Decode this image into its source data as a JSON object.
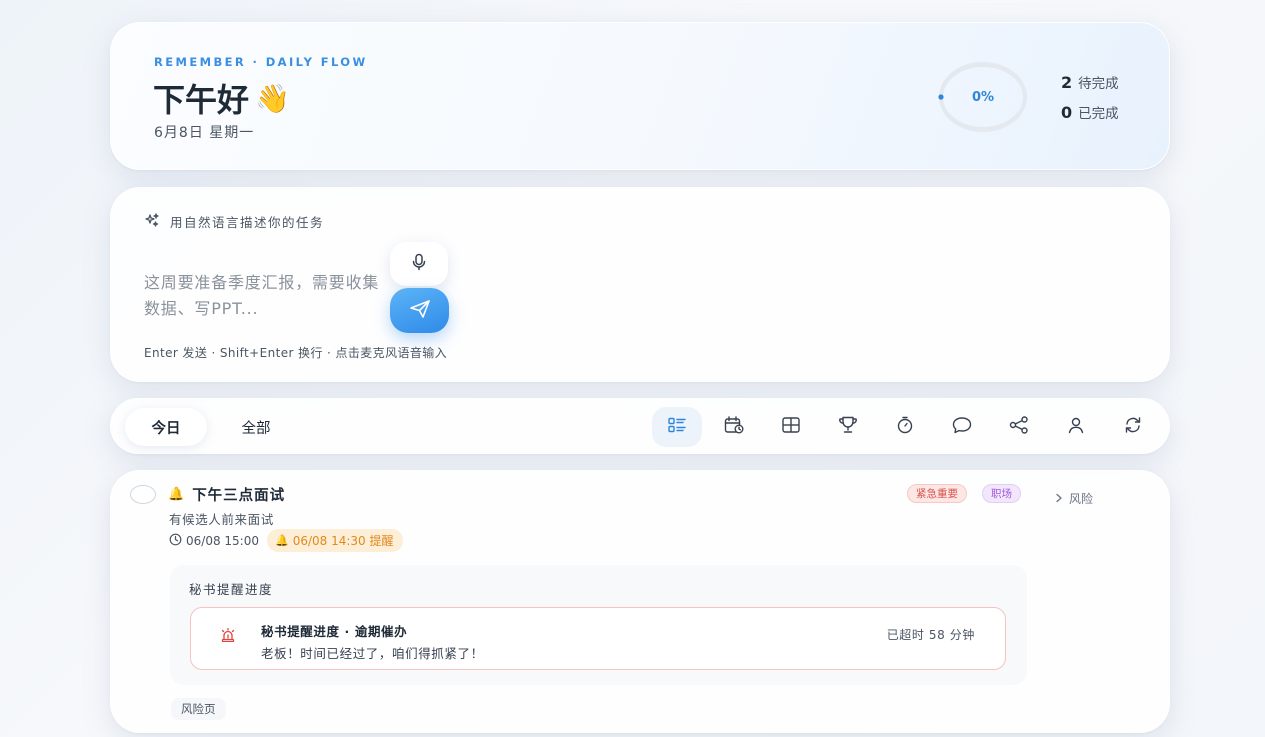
{
  "header": {
    "eyebrow": "REMEMBER · DAILY FLOW",
    "greeting": "下午好",
    "greeting_emoji": "👋",
    "date": "6月8日 星期一",
    "progress_label": "0%",
    "progress_value": 0,
    "pending_count": "2",
    "pending_label": "待完成",
    "done_count": "0",
    "done_label": "已完成",
    "accent_color": "#2f86d8"
  },
  "composer": {
    "hint": "用自然语言描述你的任务",
    "placeholder": "这周要准备季度汇报，需要收集数据、写PPT...",
    "shortcut_hint": "Enter 发送 · Shift+Enter 换行 · 点击麦克风语音输入",
    "mic_icon": "microphone-icon",
    "send_icon": "send-icon"
  },
  "tabs": {
    "today": "今日",
    "all": "全部",
    "views": [
      {
        "name": "list-view-icon",
        "active": true
      },
      {
        "name": "calendar-view-icon",
        "active": false
      },
      {
        "name": "grid-view-icon",
        "active": false
      },
      {
        "name": "trophy-icon",
        "active": false
      },
      {
        "name": "timer-icon",
        "active": false
      },
      {
        "name": "chat-icon",
        "active": false
      },
      {
        "name": "share-icon",
        "active": false
      },
      {
        "name": "profile-icon",
        "active": false
      },
      {
        "name": "refresh-icon",
        "active": false
      }
    ]
  },
  "task": {
    "bell": "🔔",
    "title": "下午三点面试",
    "description": "有候选人前来面试",
    "due": "06/08 15:00",
    "reminder": "06/08 14:30 提醒",
    "tags": {
      "urgent": "紧急重要",
      "work": "职场"
    },
    "risk_toggle": "风险",
    "secretary_title": "秘书提醒进度",
    "alert": {
      "title": "秘书提醒进度 · 逾期催办",
      "message": "老板！时间已经过了，咱们得抓紧了！",
      "overdue": "已超时 58 分钟"
    },
    "risk_page": "风险页"
  }
}
